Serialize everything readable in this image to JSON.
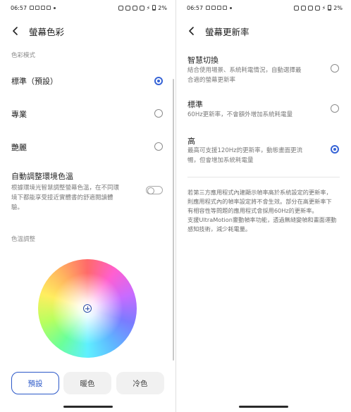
{
  "status_bar": {
    "time": "06:57",
    "battery": "2%"
  },
  "left": {
    "title": "螢幕色彩",
    "section_color_mode": "色彩模式",
    "modes": [
      {
        "label": "標準（預設）",
        "selected": true
      },
      {
        "label": "專業",
        "selected": false
      },
      {
        "label": "艷麗",
        "selected": false
      }
    ],
    "auto_adjust": {
      "label": "自動調整環境色溫",
      "desc_line1": "根據環境光智慧調整螢幕色溫，在不同環",
      "desc_line2": "境下都能享受接近實體書的舒適閱讀體",
      "desc_line3": "驗。",
      "enabled": false
    },
    "section_temp": "色溫調整",
    "presets": [
      {
        "label": "預設",
        "selected": true
      },
      {
        "label": "暖色",
        "selected": false
      },
      {
        "label": "冷色",
        "selected": false
      }
    ],
    "colors": {
      "accent": "#3764d6"
    }
  },
  "right": {
    "title": "螢幕更新率",
    "options": [
      {
        "label": "智慧切換",
        "desc_line1": "結合使用場景、系統耗電情況，自動選擇最",
        "desc_line2": "合適的螢幕更新率",
        "selected": false
      },
      {
        "label": "標準",
        "desc_line1": "60Hz更新率，不會額外增加系統耗電量",
        "desc_line2": "",
        "selected": false
      },
      {
        "label": "高",
        "desc_line1": "最高可支援120Hz的更新率，動態畫面更流",
        "desc_line2": "暢，但會增加系統耗電量",
        "selected": true
      }
    ],
    "note_lines": [
      "若第三方應用程式內建顯示幀率高於系統設定的更新率，",
      "則應用程式內的幀率設定將不會生效。部分在高更新率下",
      "有相容性等問題的應用程式會採用60Hz的更新率。",
      "支援UltraMotion靈動幀率功能，透過無縫變幀和畫面運動",
      "感知技術，減少耗電量。"
    ]
  }
}
